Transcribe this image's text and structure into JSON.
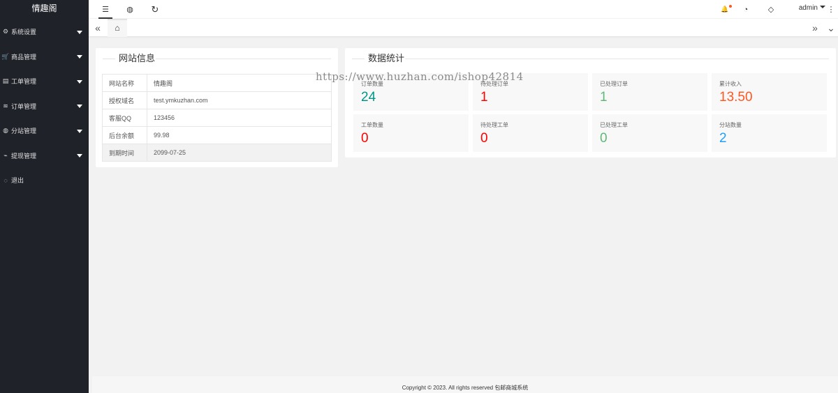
{
  "app": {
    "brand": "情趣阁"
  },
  "sidebar": {
    "items": [
      {
        "label": "系统设置",
        "icon": "gear-icon",
        "glyph": "⚙"
      },
      {
        "label": "商品管理",
        "icon": "cart-icon",
        "glyph": "🛒"
      },
      {
        "label": "工单管理",
        "icon": "form-icon",
        "glyph": "▤"
      },
      {
        "label": "订单管理",
        "icon": "layers-icon",
        "glyph": "≋"
      },
      {
        "label": "分站管理",
        "icon": "globe-icon",
        "glyph": "◍"
      },
      {
        "label": "提现管理",
        "icon": "chart-icon",
        "glyph": "⌁"
      },
      {
        "label": "退出",
        "icon": "shield-icon",
        "glyph": "◌"
      }
    ]
  },
  "header": {
    "menu_glyph": "☰",
    "globe_glyph": "◍",
    "refresh_glyph": "↻",
    "bell_glyph": "🔔",
    "theme_glyph": "◔",
    "tag_glyph": "◇",
    "more_glyph": "⋮",
    "user": "admin"
  },
  "tabs": {
    "prev_glyph": "«",
    "home_glyph": "⌂",
    "next_glyph": "»",
    "dropdown_glyph": "⌄"
  },
  "site_info": {
    "title": "网站信息",
    "rows": [
      {
        "key": "网站名称",
        "value": "情趣阁"
      },
      {
        "key": "授权域名",
        "value": "test.ymkuzhan.com"
      },
      {
        "key": "客服QQ",
        "value": "123456"
      },
      {
        "key": "后台余额",
        "value": "99.98"
      },
      {
        "key": "到期时间",
        "value": "2099-07-25"
      }
    ]
  },
  "stats": {
    "title": "数据统计",
    "items": [
      {
        "label": "订单数量",
        "value": "24",
        "color": "#009688"
      },
      {
        "label": "待处理订单",
        "value": "1",
        "color": "#ff0000"
      },
      {
        "label": "已处理订单",
        "value": "1",
        "color": "#5fb878"
      },
      {
        "label": "累计收入",
        "value": "13.50",
        "color": "#ff5722"
      },
      {
        "label": "工单数量",
        "value": "0",
        "color": "#ff0000"
      },
      {
        "label": "待处理工单",
        "value": "0",
        "color": "#ff0000"
      },
      {
        "label": "已处理工单",
        "value": "0",
        "color": "#5fb878"
      },
      {
        "label": "分站数量",
        "value": "2",
        "color": "#1e9fff"
      }
    ]
  },
  "watermark": "https://www.huzhan.com/ishop42814",
  "footer": {
    "copyright": "Copyright © 2023. All rights reserved 包邮商城系统"
  }
}
